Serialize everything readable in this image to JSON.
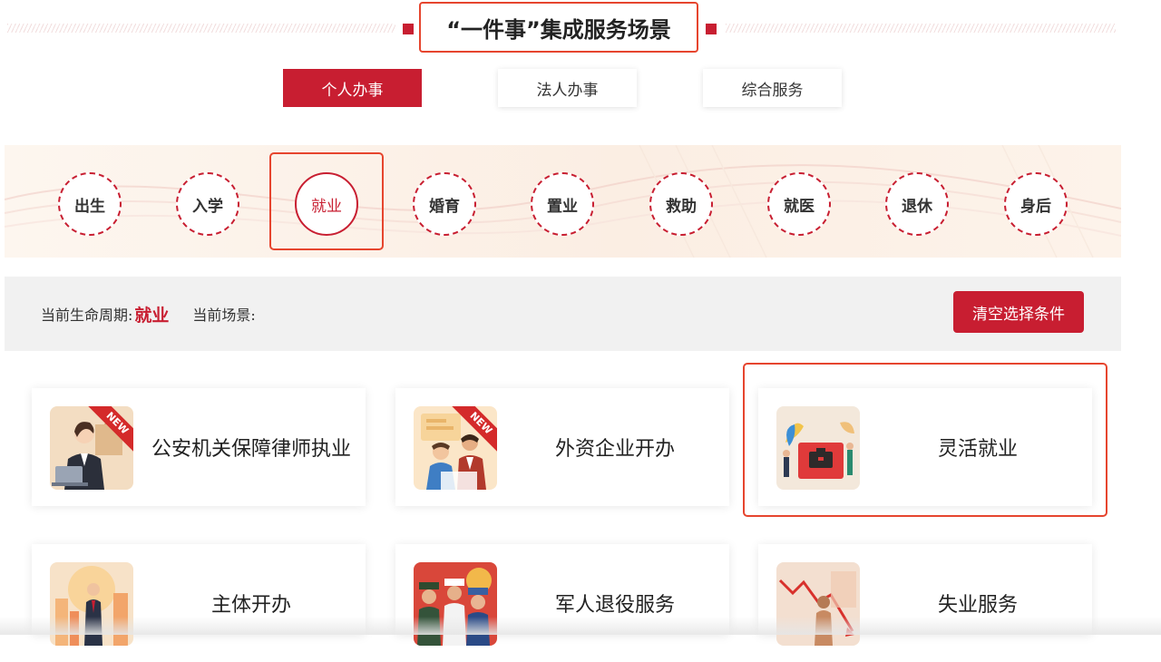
{
  "title": "“一件事”集成服务场景",
  "tabs": [
    {
      "label": "个人办事",
      "active": true
    },
    {
      "label": "法人办事",
      "active": false
    },
    {
      "label": "综合服务",
      "active": false
    }
  ],
  "life_stages": [
    {
      "label": "出生"
    },
    {
      "label": "入学"
    },
    {
      "label": "就业",
      "active": true
    },
    {
      "label": "婚育"
    },
    {
      "label": "置业"
    },
    {
      "label": "救助"
    },
    {
      "label": "就医"
    },
    {
      "label": "退休"
    },
    {
      "label": "身后"
    }
  ],
  "status_bar": {
    "lifecycle_label": "当前生命周期:",
    "lifecycle_value": "就业",
    "scene_label": "当前场景:",
    "clear_button": "清空选择条件"
  },
  "cards": [
    {
      "label": "公安机关保障律师执业",
      "badge": "NEW",
      "icon": "lawyer-illustration-icon"
    },
    {
      "label": "外资企业开办",
      "badge": "NEW",
      "icon": "business-meeting-illustration-icon"
    },
    {
      "label": "灵活就业",
      "icon": "briefcase-illustration-icon"
    },
    {
      "label": "主体开办",
      "icon": "businessman-city-illustration-icon"
    },
    {
      "label": "军人退役服务",
      "icon": "soldiers-illustration-icon"
    },
    {
      "label": "失业服务",
      "icon": "downturn-chart-illustration-icon"
    }
  ],
  "colors": {
    "accent": "#c81e31",
    "highlight": "#e6452e"
  }
}
